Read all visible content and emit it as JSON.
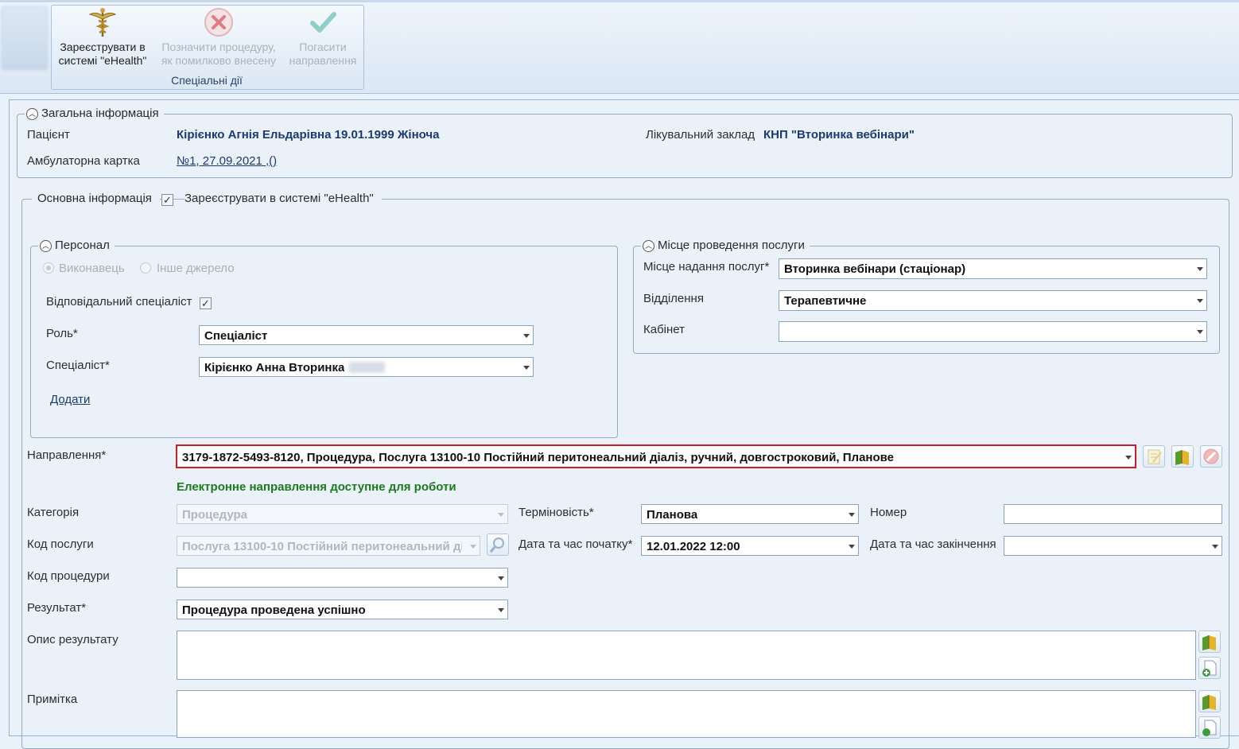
{
  "ribbon": {
    "buttons": [
      {
        "label": "Зареєструвати в\nсистемі \"eHealth\"",
        "icon": "caduceus-icon",
        "enabled": true
      },
      {
        "label": "Позначити процедуру,\nяк помилково внесену",
        "icon": "red-x-icon",
        "enabled": false
      },
      {
        "label": "Погасити\nнаправлення",
        "icon": "checkmark-icon",
        "enabled": false
      }
    ],
    "group_label": "Спеціальні дії"
  },
  "general": {
    "legend": "Загальна інформація",
    "patient_label": "Пацієнт",
    "patient_value": "Кірієнко Агнія Ельдарівна 19.01.1999 Жіноча",
    "facility_label": "Лікувальний заклад",
    "facility_value": "КНП \"Вторинка вебінари\"",
    "card_label": "Амбулаторна картка",
    "card_value": "№1, 27.09.2021 ,()"
  },
  "main": {
    "legend": "Основна інформація",
    "register_label": "Зареєструвати в системі \"eHealth\"",
    "register_checked": true
  },
  "personnel": {
    "legend": "Персонал",
    "radio_performer": "Виконавець",
    "radio_other": "Інше джерело",
    "responsible_label": "Відповідальний спеціаліст",
    "responsible_checked": true,
    "role_label": "Роль*",
    "role_value": "Спеціаліст",
    "specialist_label": "Спеціаліст*",
    "specialist_value": "Кірієнко Анна Вторинка",
    "add_link": "Додати"
  },
  "place": {
    "legend": "Місце проведення послуги",
    "place_label": "Місце надання послуг*",
    "place_value": "Вторинка вебінари (стаціонар)",
    "dept_label": "Відділення",
    "dept_value": "Терапевтичне",
    "cabinet_label": "Кабінет",
    "cabinet_value": ""
  },
  "referral": {
    "label": "Направлення*",
    "value": "3179-1872-5493-8120, Процедура, Послуга 13100-10 Постійний перитонеальний діаліз, ручний, довгостроковий, Планове",
    "status": "Електронне направлення доступне для роботи",
    "status_color": "#1d7a1d"
  },
  "form": {
    "category_label": "Категорія",
    "category_value": "Процедура",
    "urgency_label": "Терміновість*",
    "urgency_value": "Планова",
    "number_label": "Номер",
    "number_value": "",
    "service_code_label": "Код послуги",
    "service_code_value": "Послуга 13100-10 Постійний перитонеальний ді",
    "start_label": "Дата та час початку*",
    "start_value": "12.01.2022 12:00",
    "end_label": "Дата та час закінчення",
    "end_value": "",
    "procedure_code_label": "Код процедури",
    "procedure_code_value": "",
    "result_label": "Результат*",
    "result_value": "Процедура проведена успішно",
    "result_desc_label": "Опис результату",
    "note_label": "Примітка"
  },
  "colors": {
    "highlight_border": "#d11b24",
    "accent_text": "#1c3a6e"
  }
}
